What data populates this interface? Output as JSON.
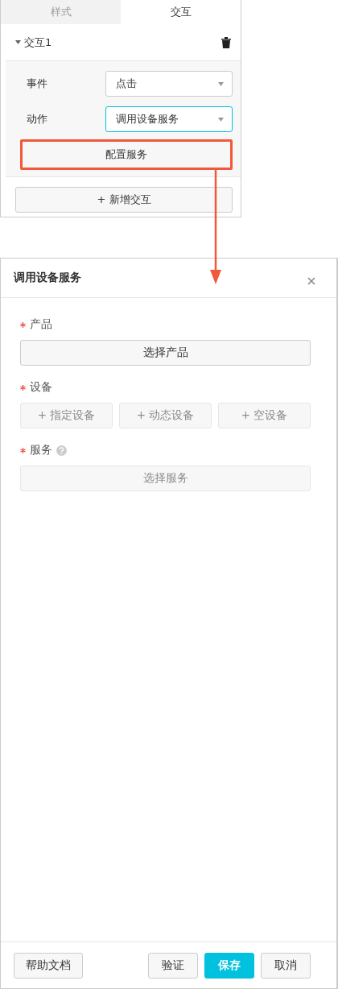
{
  "panel": {
    "tabs": [
      {
        "label": "样式",
        "selected": false
      },
      {
        "label": "交互",
        "selected": true
      }
    ],
    "interaction": {
      "title": "交互1",
      "expanded": true,
      "fields": [
        {
          "label": "事件",
          "value": "点击",
          "focused": false
        },
        {
          "label": "动作",
          "value": "调用设备服务",
          "focused": true
        }
      ],
      "config_button": {
        "label": "配置服务",
        "highlighted": true
      }
    },
    "add_button": "+ 新增交互"
  },
  "dialog": {
    "title": "调用设备服务",
    "fields": [
      {
        "label": "产品",
        "required": true,
        "help": false,
        "buttons": [
          {
            "label": "选择产品",
            "disabled": false
          }
        ]
      },
      {
        "label": "设备",
        "required": true,
        "help": false,
        "buttons": [
          {
            "label": "+ 指定设备",
            "disabled": true
          },
          {
            "label": "+ 动态设备",
            "disabled": true
          },
          {
            "label": "+ 空设备",
            "disabled": true
          }
        ]
      },
      {
        "label": "服务",
        "required": true,
        "help": true,
        "buttons": [
          {
            "label": "选择服务",
            "disabled": true
          }
        ]
      }
    ],
    "footer_left": [
      "帮助文档"
    ],
    "footer_right": [
      {
        "label": "验证",
        "kind": "default"
      },
      {
        "label": "保存",
        "kind": "primary"
      },
      {
        "label": "取消",
        "kind": "default"
      }
    ]
  }
}
